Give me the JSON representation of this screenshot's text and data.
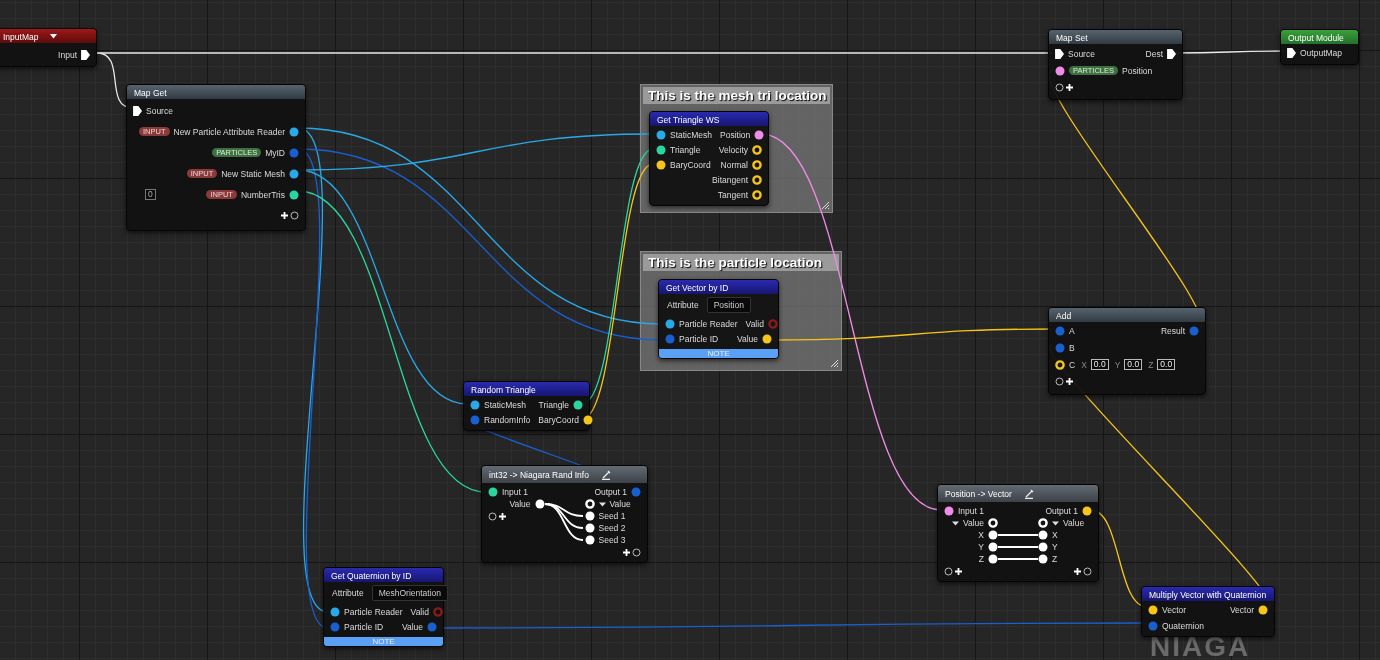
{
  "comments": [
    {
      "title": "This is the mesh tri location"
    },
    {
      "title": "This is the particle location"
    }
  ],
  "nodes": [
    {
      "kind": "input_map",
      "title": "InputMap",
      "dropdown": true,
      "rows": [
        {
          "right": {
            "kind": "exec",
            "label": "Input",
            "connected": true
          }
        }
      ]
    },
    {
      "kind": "map",
      "title": "Map Get",
      "rows": [
        {
          "left": {
            "kind": "exec",
            "label": "Source",
            "connected": true
          }
        },
        {
          "right": {
            "kind": "data",
            "label": "New Particle Attribute Reader",
            "tag": {
              "text": "INPUT",
              "kind": "input"
            },
            "color": "#29a9e8",
            "connected": true
          }
        },
        {
          "right": {
            "kind": "data",
            "label": "MyID",
            "tag": {
              "text": "PARTICLES",
              "kind": "particles"
            },
            "color": "#1a5fd0",
            "connected": true
          }
        },
        {
          "right": {
            "kind": "data",
            "label": "New Static Mesh",
            "tag": {
              "text": "INPUT",
              "kind": "input"
            },
            "color": "#29a9e8",
            "connected": true
          }
        },
        {
          "value_box": "0",
          "right": {
            "kind": "data",
            "label": "NumberTris",
            "tag": {
              "text": "INPUT",
              "kind": "input"
            },
            "color": "#2ad6a0",
            "connected": true
          }
        },
        {
          "right": {
            "kind": "add"
          }
        }
      ]
    },
    {
      "kind": "function",
      "title": "Get Triangle WS",
      "rows": [
        {
          "left": {
            "kind": "data",
            "label": "StaticMesh",
            "color": "#29a9e8",
            "connected": true
          },
          "right": {
            "kind": "data",
            "label": "Position",
            "color": "#f08ce8",
            "connected": true
          }
        },
        {
          "left": {
            "kind": "data",
            "label": "Triangle",
            "color": "#2ad6a0",
            "connected": true
          },
          "right": {
            "kind": "data",
            "label": "Velocity",
            "color": "#f5c518",
            "connected": false
          }
        },
        {
          "left": {
            "kind": "data",
            "label": "BaryCoord",
            "color": "#f5c518",
            "connected": true
          },
          "right": {
            "kind": "data",
            "label": "Normal",
            "color": "#f5c518",
            "connected": false
          }
        },
        {
          "right": {
            "kind": "data",
            "label": "Bitangent",
            "color": "#f5c518",
            "connected": false
          }
        },
        {
          "right": {
            "kind": "data",
            "label": "Tangent",
            "color": "#f5c518",
            "connected": false
          }
        }
      ]
    },
    {
      "kind": "function",
      "title": "Get Vector by ID",
      "note": "NOTE",
      "rows": [
        {
          "kind": "attribute",
          "label": "Attribute",
          "value": "Position"
        },
        {
          "left": {
            "kind": "data",
            "label": "Particle Reader",
            "color": "#29a9e8",
            "connected": true
          },
          "right": {
            "kind": "data",
            "label": "Valid",
            "color": "#8a1a1a",
            "connected": false
          }
        },
        {
          "left": {
            "kind": "data",
            "label": "Particle ID",
            "color": "#1a5fd0",
            "connected": true
          },
          "right": {
            "kind": "data",
            "label": "Value",
            "color": "#f5c518",
            "connected": true
          }
        }
      ]
    },
    {
      "kind": "map",
      "title": "Map Set",
      "rows": [
        {
          "left": {
            "kind": "exec",
            "label": "Source",
            "connected": true
          },
          "right": {
            "kind": "exec",
            "label": "Dest",
            "connected": true
          }
        },
        {
          "left": {
            "kind": "data",
            "label": "Position",
            "tag": {
              "text": "PARTICLES",
              "kind": "particles"
            },
            "color": "#f08ce8",
            "connected": true
          }
        },
        {
          "left": {
            "kind": "add"
          }
        }
      ]
    },
    {
      "kind": "output",
      "title": "Output Module",
      "rows": [
        {
          "left": {
            "kind": "exec",
            "label": "OutputMap",
            "connected": true
          }
        }
      ]
    },
    {
      "kind": "map",
      "title": "Add",
      "rows": [
        {
          "left": {
            "kind": "data",
            "label": "A",
            "color": "#1a5fd0",
            "connected": true
          },
          "right": {
            "kind": "data",
            "label": "Result",
            "color": "#1a5fd0",
            "connected": true
          }
        },
        {
          "left": {
            "kind": "data",
            "label": "B",
            "color": "#1a5fd0",
            "connected": true
          }
        },
        {
          "left": {
            "kind": "data",
            "label": "C",
            "color": "#f5c518",
            "connected": false,
            "fields": [
              {
                "axis": "X",
                "value": "0.0"
              },
              {
                "axis": "Y",
                "value": "0.0"
              },
              {
                "axis": "Z",
                "value": "0.0"
              }
            ]
          }
        },
        {
          "left": {
            "kind": "add"
          }
        }
      ]
    },
    {
      "kind": "function",
      "title": "Random Triangle",
      "rows": [
        {
          "left": {
            "kind": "data",
            "label": "StaticMesh",
            "color": "#29a9e8",
            "connected": true
          },
          "right": {
            "kind": "data",
            "label": "Triangle",
            "color": "#2ad6a0",
            "connected": true
          }
        },
        {
          "left": {
            "kind": "data",
            "label": "RandomInfo",
            "color": "#1a5fd0",
            "connected": true
          },
          "right": {
            "kind": "data",
            "label": "BaryCoord",
            "color": "#f5c518",
            "connected": true
          }
        }
      ]
    },
    {
      "kind": "conversion",
      "title": "int32 -> Niagara Rand Info",
      "editable": true,
      "rows": [
        {
          "left": {
            "kind": "data",
            "label": "Input 1",
            "color": "#2ad6a0",
            "connected": true
          },
          "right": {
            "kind": "data",
            "label": "Output 1",
            "color": "#1a5fd0",
            "connected": true
          }
        },
        {
          "kind": "split",
          "left": {
            "kind": "data",
            "inner": true,
            "label": "Value",
            "color": "#ffffff",
            "connected": true
          },
          "right": {
            "kind": "data",
            "inner": true,
            "expanded": true,
            "label": "Value",
            "color": "#ffffff",
            "connected": false
          }
        },
        {
          "left": {
            "kind": "add"
          },
          "right": {
            "kind": "data",
            "inner": true,
            "label": "Seed 1",
            "color": "#ffffff",
            "connected": true
          }
        },
        {
          "right": {
            "kind": "data",
            "inner": true,
            "label": "Seed 2",
            "color": "#ffffff",
            "connected": true
          }
        },
        {
          "right": {
            "kind": "data",
            "inner": true,
            "label": "Seed 3",
            "color": "#ffffff",
            "connected": true
          }
        },
        {
          "right": {
            "kind": "add"
          }
        }
      ]
    },
    {
      "kind": "function",
      "title": "Get Quaternion by ID",
      "note": "NOTE",
      "rows": [
        {
          "kind": "attribute",
          "label": "Attribute",
          "value": "MeshOrientation"
        },
        {
          "left": {
            "kind": "data",
            "label": "Particle Reader",
            "color": "#29a9e8",
            "connected": true
          },
          "right": {
            "kind": "data",
            "label": "Valid",
            "color": "#8a1a1a",
            "connected": false
          }
        },
        {
          "left": {
            "kind": "data",
            "label": "Particle ID",
            "color": "#1a5fd0",
            "connected": true
          },
          "right": {
            "kind": "data",
            "label": "Value",
            "color": "#1a5fd0",
            "connected": true
          }
        }
      ]
    },
    {
      "kind": "conversion",
      "title": "Position -> Vector",
      "editable": true,
      "rows": [
        {
          "left": {
            "kind": "data",
            "label": "Input 1",
            "color": "#f08ce8",
            "connected": true
          },
          "right": {
            "kind": "data",
            "label": "Output 1",
            "color": "#f5c518",
            "connected": true
          }
        },
        {
          "left": {
            "kind": "data",
            "inner": true,
            "expanded": true,
            "label": "Value",
            "color": "#ffffff",
            "connected": false
          },
          "right": {
            "kind": "data",
            "inner": true,
            "expanded": true,
            "label": "Value",
            "color": "#ffffff",
            "connected": false
          }
        },
        {
          "kind": "bridge",
          "left": {
            "kind": "data",
            "inner": true,
            "label": "X",
            "color": "#ffffff",
            "connected": true
          },
          "right": {
            "kind": "data",
            "inner": true,
            "label": "X",
            "color": "#ffffff",
            "connected": true
          }
        },
        {
          "kind": "bridge",
          "left": {
            "kind": "data",
            "inner": true,
            "label": "Y",
            "color": "#ffffff",
            "connected": true
          },
          "right": {
            "kind": "data",
            "inner": true,
            "label": "Y",
            "color": "#ffffff",
            "connected": true
          }
        },
        {
          "kind": "bridge",
          "left": {
            "kind": "data",
            "inner": true,
            "label": "Z",
            "color": "#ffffff",
            "connected": true
          },
          "right": {
            "kind": "data",
            "inner": true,
            "label": "Z",
            "color": "#ffffff",
            "connected": true
          }
        },
        {
          "left": {
            "kind": "add"
          },
          "right": {
            "kind": "add"
          }
        }
      ]
    },
    {
      "kind": "function",
      "title": "Multiply Vector with Quaternion",
      "rows": [
        {
          "left": {
            "kind": "data",
            "label": "Vector",
            "color": "#f5c518",
            "connected": true
          },
          "right": {
            "kind": "data",
            "label": "Vector",
            "color": "#f5c518",
            "connected": true
          }
        },
        {
          "left": {
            "kind": "data",
            "label": "Quaternion",
            "color": "#1a5fd0",
            "connected": true
          }
        }
      ]
    }
  ],
  "watermark": "NIAGA"
}
